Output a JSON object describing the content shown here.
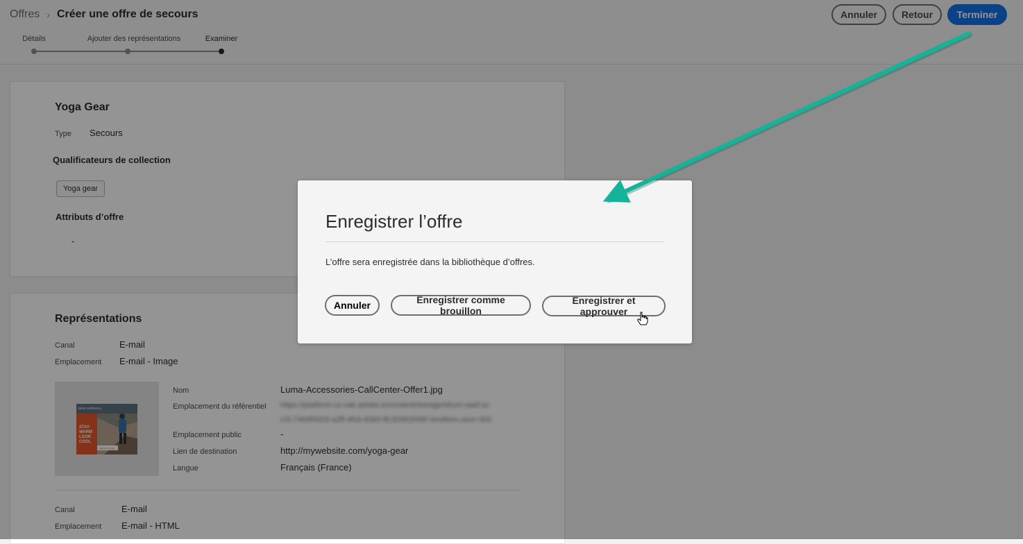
{
  "header": {
    "breadcrumb": {
      "root": "Offres",
      "separator": "›",
      "current": "Créer une offre de secours"
    },
    "steps": [
      {
        "label": "Détails"
      },
      {
        "label": "Ajouter des représentations"
      },
      {
        "label": "Examiner"
      }
    ],
    "buttons": {
      "cancel": "Annuler",
      "back": "Retour",
      "finish": "Terminer"
    }
  },
  "offer": {
    "name": "Yoga Gear",
    "type_label": "Type",
    "type_value": "Secours",
    "qualifiers_title": "Qualificateurs de collection",
    "qualifier_tag": "Yoga gear",
    "attributes_title": "Attributs d’offre",
    "attributes_value": "-"
  },
  "representations": {
    "title": "Représentations",
    "items": [
      {
        "channel_label": "Canal",
        "channel": "E-mail",
        "placement_label": "Emplacement",
        "placement": "E-mail - Image",
        "details": {
          "name_label": "Nom",
          "name": "Luma-Accessories-CallCenter-Offer1.jpg",
          "repo_label": "Emplacement du référentiel",
          "repo_line1": "https://platform-cs-vak.adobe.io/content/storage/id/urn:aaid:sc",
          "repo_line2": "US:7484f0003-a2ff-4fcb-8360-ffc30962f49f/:rendition,size=300",
          "public_label": "Emplacement public",
          "public": "-",
          "destination_label": "Lien de destination",
          "destination": "http://mywebsite.com/yoga-gear",
          "language_label": "Langue",
          "language": "Français (France)"
        },
        "thumb": {
          "banner": "NEW ARRIVALS",
          "lines": [
            "STAY",
            "WARM",
            "LOOK",
            "COOL"
          ],
          "button": "SHOP NOW"
        }
      },
      {
        "channel_label": "Canal",
        "channel": "E-mail",
        "placement_label": "Emplacement",
        "placement": "E-mail - HTML"
      }
    ]
  },
  "modal": {
    "title": "Enregistrer l’offre",
    "message": "L’offre sera enregistrée dans la bibliothèque d’offres.",
    "buttons": {
      "cancel": "Annuler",
      "draft": "Enregistrer comme brouillon",
      "approve": "Enregistrer et approuver"
    }
  },
  "colors": {
    "primary": "#1473e6",
    "annotation_arrow": "#14b39a",
    "overlay": "#000000"
  }
}
